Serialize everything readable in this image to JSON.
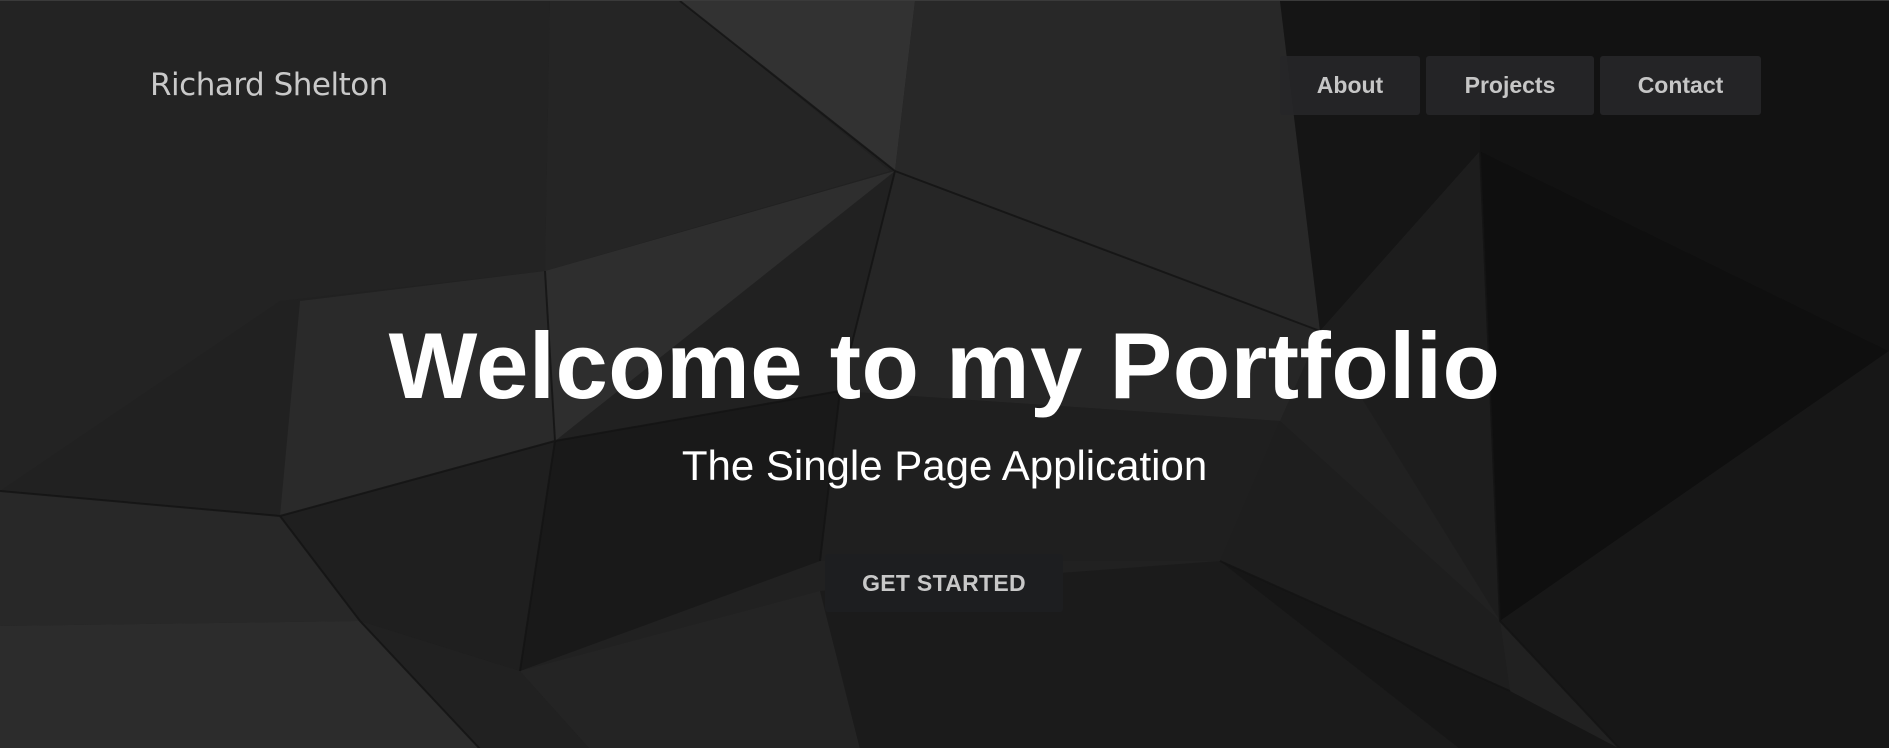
{
  "brand": {
    "name": "Richard Shelton"
  },
  "nav": {
    "items": [
      {
        "label": "About"
      },
      {
        "label": "Projects"
      },
      {
        "label": "Contact"
      }
    ]
  },
  "hero": {
    "title": "Welcome to my Portfolio",
    "subtitle": "The Single Page Application",
    "cta_label": "GET STARTED"
  },
  "colors": {
    "background": "#242424",
    "title_text": "#ffffff",
    "nav_text": "#c6c6c6",
    "button_bg": "#1e1f21"
  }
}
